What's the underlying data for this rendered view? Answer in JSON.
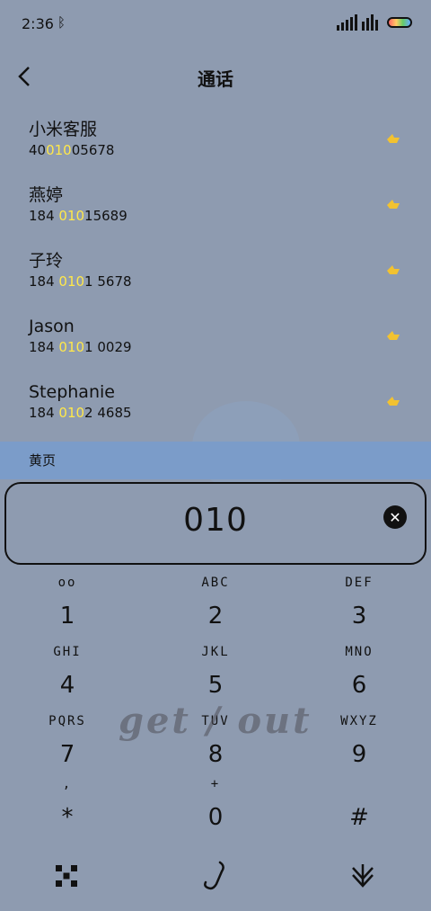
{
  "status": {
    "time": "2:36"
  },
  "header": {
    "title": "通话"
  },
  "contacts": [
    {
      "name": "小米客服",
      "num_pre": "40",
      "num_hl": "010",
      "num_post": "05678"
    },
    {
      "name": "燕婷",
      "num_pre": "184 ",
      "num_hl": "010",
      "num_post": "15689"
    },
    {
      "name": "子玲",
      "num_pre": "184 ",
      "num_hl": "010",
      "num_post": "1 5678"
    },
    {
      "name": "Jason",
      "num_pre": "184 ",
      "num_hl": "010",
      "num_post": "1 0029"
    },
    {
      "name": "Stephanie",
      "num_pre": "184 ",
      "num_hl": "010",
      "num_post": "2 4685"
    }
  ],
  "yellow_pages": {
    "label": "黄页"
  },
  "dial_input": {
    "value": "010"
  },
  "keypad": [
    {
      "letters": "oo",
      "digit": "1"
    },
    {
      "letters": "ABC",
      "digit": "2"
    },
    {
      "letters": "DEF",
      "digit": "3"
    },
    {
      "letters": "GHI",
      "digit": "4"
    },
    {
      "letters": "JKL",
      "digit": "5"
    },
    {
      "letters": "MNO",
      "digit": "6"
    },
    {
      "letters": "PQRS",
      "digit": "7"
    },
    {
      "letters": "TUV",
      "digit": "8"
    },
    {
      "letters": "WXYZ",
      "digit": "9"
    },
    {
      "letters": ",",
      "digit": "*"
    },
    {
      "letters": "+",
      "digit": "0"
    },
    {
      "letters": "",
      "digit": "#"
    }
  ],
  "watermark": {
    "text": "get / out"
  },
  "icons": {
    "bluetooth": "bluetooth-icon",
    "signal": "signal-icon",
    "wifi": "wifi-icon",
    "battery": "battery-icon",
    "back": "back-arrow-icon",
    "location": "location-icon",
    "clear": "clear-icon",
    "dialpad": "dialpad-icon",
    "call": "call-icon",
    "collapse": "collapse-keypad-icon"
  },
  "colors": {
    "background": "#8e9bb0",
    "highlight": "#ffe84a",
    "yellow_pages_bar": "#7b9cc9"
  }
}
